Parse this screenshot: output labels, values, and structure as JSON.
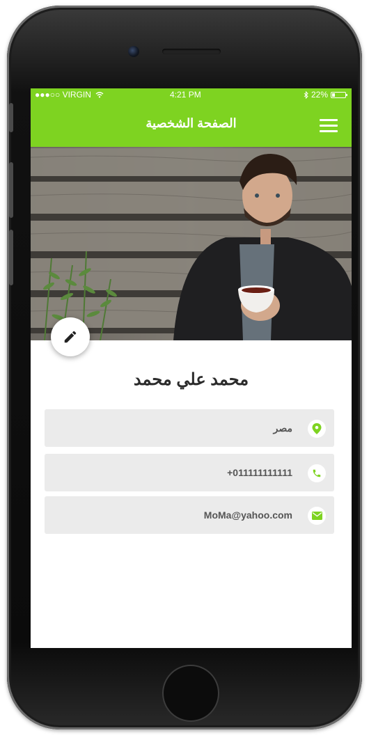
{
  "status_bar": {
    "carrier": "●●●○○ VIRGIN",
    "time": "4:21 PM",
    "battery": "22%"
  },
  "header": {
    "title": "الصفحة الشخصية"
  },
  "profile": {
    "name": "محمد علي محمد",
    "location": "مصر",
    "phone": "+011111111111",
    "email": "MoMa@yahoo.com"
  },
  "icons": {
    "menu": "menu-icon",
    "edit": "pencil-icon",
    "location": "map-pin-icon",
    "phone": "phone-icon",
    "email": "envelope-icon"
  },
  "colors": {
    "accent": "#7ed321",
    "row_bg": "#ebebeb"
  }
}
